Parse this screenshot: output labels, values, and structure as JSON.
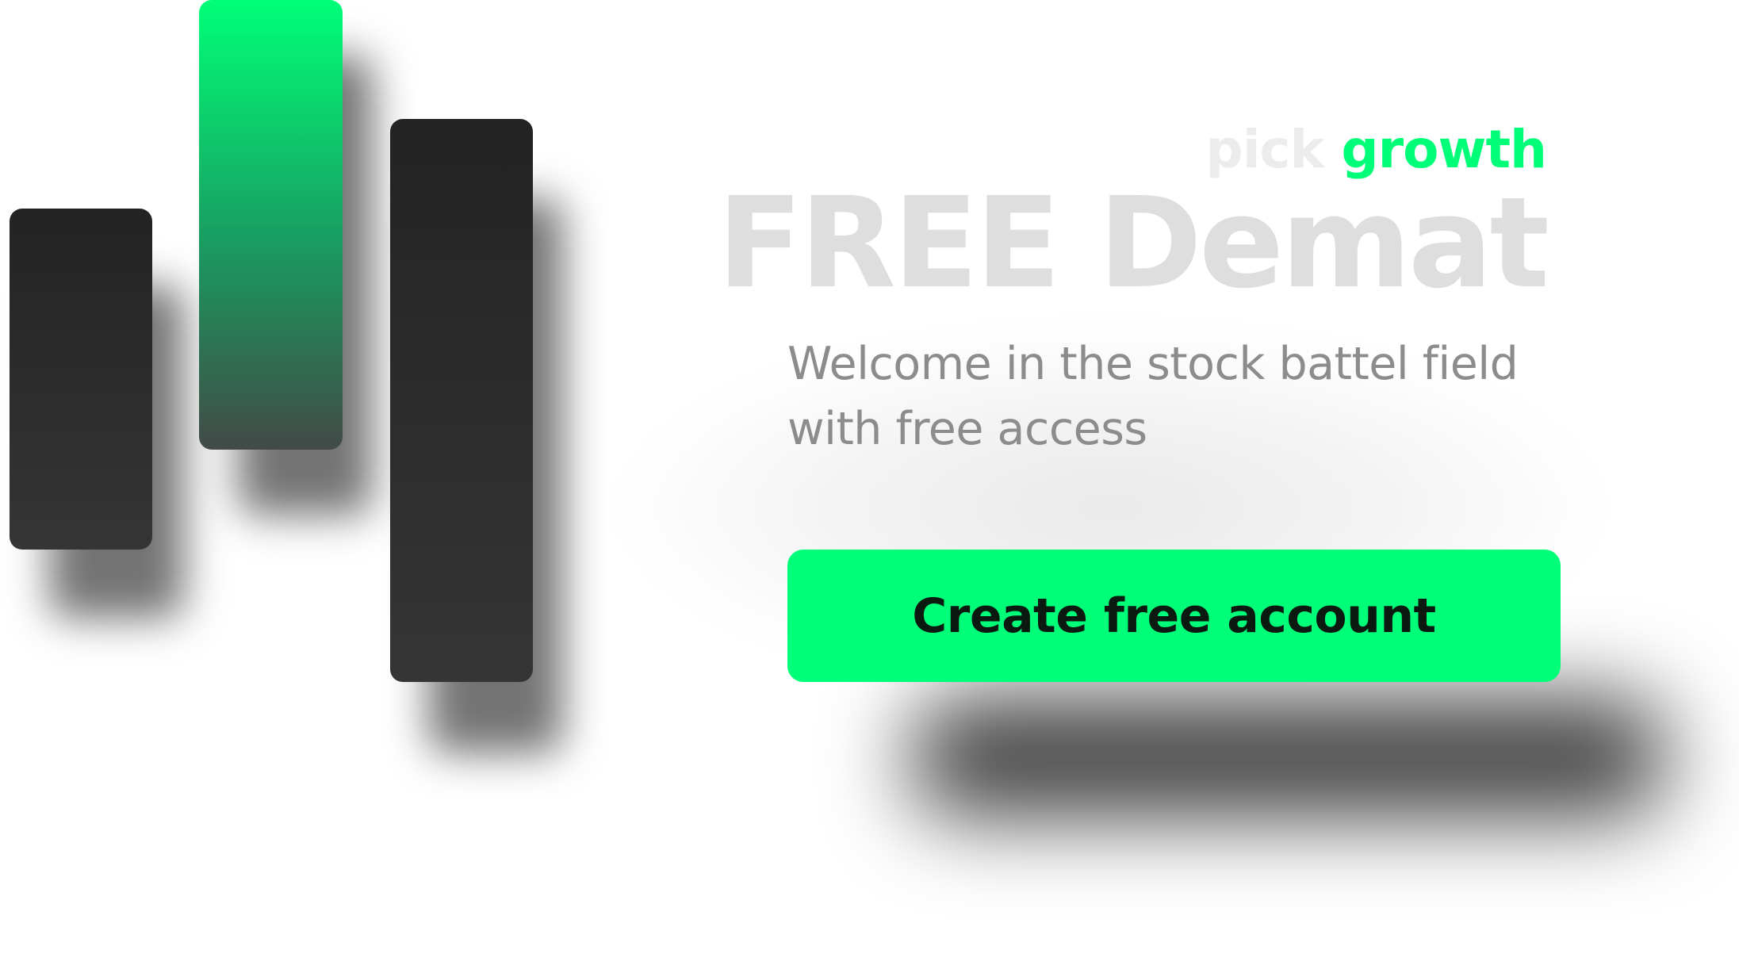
{
  "brand": {
    "pick": "pick",
    "growth": "growth"
  },
  "hero": {
    "headline": "FREE Demat",
    "subtitle": "Welcome in the stock battel field with free access"
  },
  "cta": {
    "label": "Create free account"
  },
  "colors": {
    "accent": "#00ff78",
    "bar_dark": "#2a2a2a",
    "headline": "#dedede",
    "subtitle": "#8c8c8c",
    "button_text": "#0a1a10"
  },
  "logo": {
    "icon": "candlestick-bars-icon"
  }
}
